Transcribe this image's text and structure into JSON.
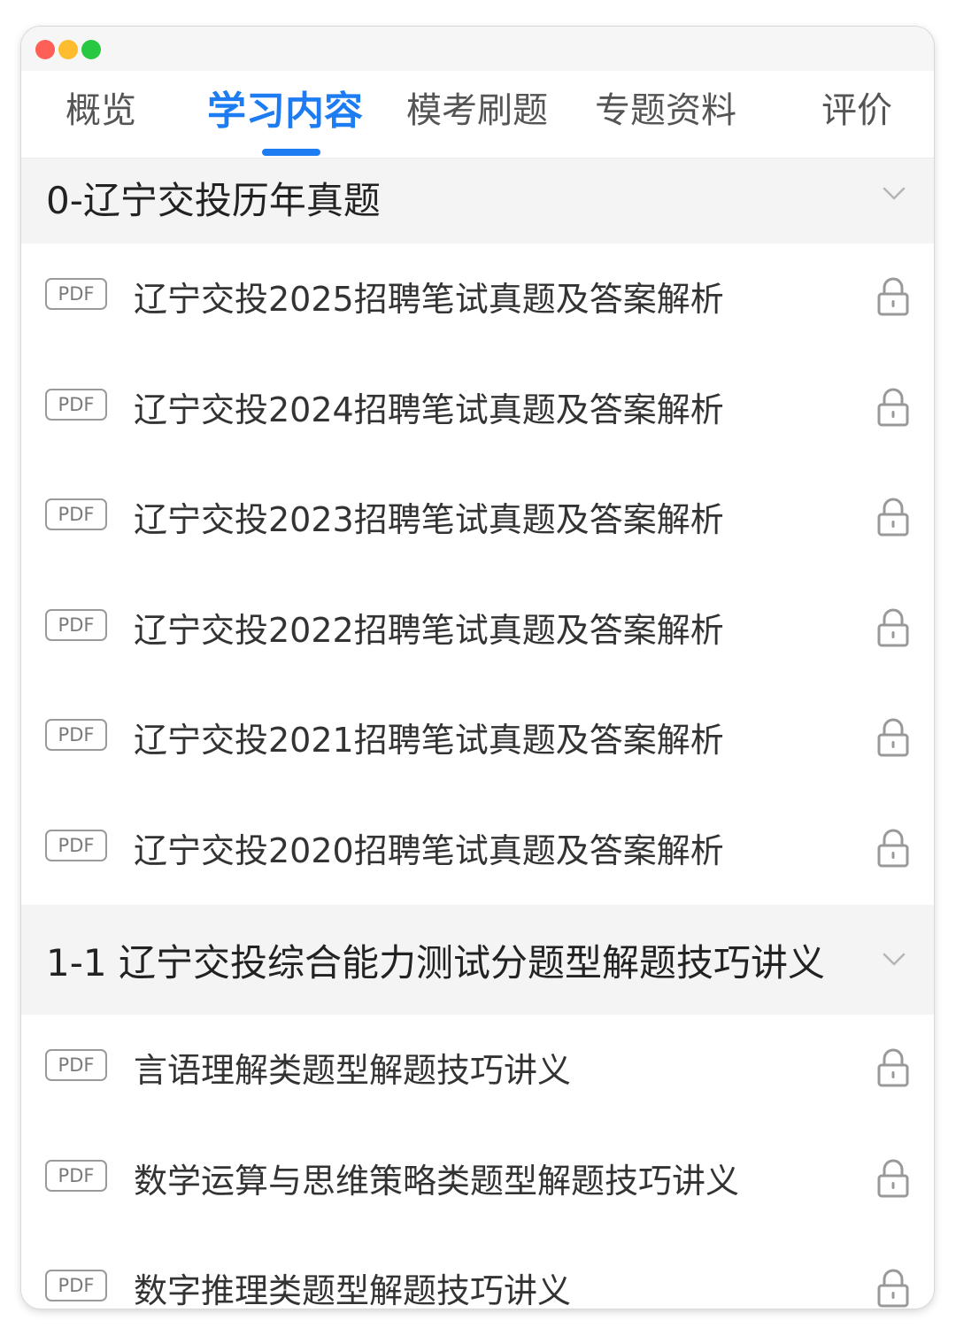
{
  "tabs": [
    {
      "label": "概览"
    },
    {
      "label": "学习内容"
    },
    {
      "label": "模考刷题"
    },
    {
      "label": "专题资料"
    },
    {
      "label": "评价"
    }
  ],
  "sections": [
    {
      "title": "0-辽宁交投历年真题",
      "items": [
        {
          "badge": "PDF",
          "title": "辽宁交投2025招聘笔试真题及答案解析"
        },
        {
          "badge": "PDF",
          "title": "辽宁交投2024招聘笔试真题及答案解析"
        },
        {
          "badge": "PDF",
          "title": "辽宁交投2023招聘笔试真题及答案解析"
        },
        {
          "badge": "PDF",
          "title": "辽宁交投2022招聘笔试真题及答案解析"
        },
        {
          "badge": "PDF",
          "title": "辽宁交投2021招聘笔试真题及答案解析"
        },
        {
          "badge": "PDF",
          "title": "辽宁交投2020招聘笔试真题及答案解析"
        }
      ]
    },
    {
      "title": "1-1 辽宁交投综合能力测试分题型解题技巧讲义",
      "items": [
        {
          "badge": "PDF",
          "title": "言语理解类题型解题技巧讲义"
        },
        {
          "badge": "PDF",
          "title": "数学运算与思维策略类题型解题技巧讲义"
        },
        {
          "badge": "PDF",
          "title": "数字推理类题型解题技巧讲义"
        }
      ]
    }
  ],
  "colors": {
    "accent": "#1e7cf2",
    "section_bg": "#f4f4f4",
    "badge_border": "#9a9a9a"
  },
  "icons": {
    "chevron": "chevron-down-icon",
    "lock": "lock-icon"
  }
}
